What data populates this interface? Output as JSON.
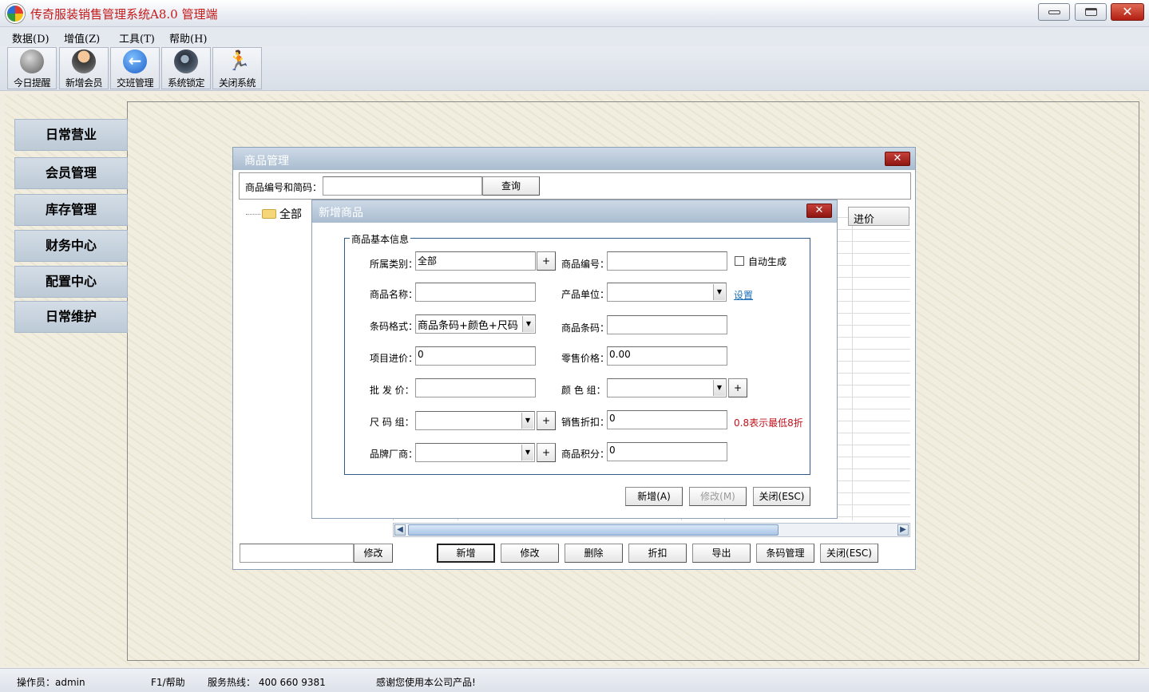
{
  "app": {
    "title": "传奇服装销售管理系统A8.0 管理端",
    "close_glyph": "✕"
  },
  "menu": [
    "数据(D)",
    "增值(Z)",
    "工具(T)",
    "帮助(H)"
  ],
  "toolbar": [
    "今日提醒",
    "新增会员",
    "交班管理",
    "系统锁定",
    "关闭系统"
  ],
  "nav": [
    "日常营业",
    "会员管理",
    "库存管理",
    "财务中心",
    "配置中心",
    "日常维护"
  ],
  "product_manager": {
    "title": "商品管理",
    "search_label": "商品编号和简码：",
    "search_value": "",
    "search_button": "查询",
    "tree_root": "全部",
    "grid_header": "进价",
    "bottom_input_value": "",
    "buttons": [
      "修改",
      "新增",
      "修改",
      "删除",
      "折扣",
      "导出",
      "条码管理",
      "关闭(ESC)"
    ]
  },
  "add_product": {
    "title": "新增商品",
    "group_title": "商品基本信息",
    "fields": {
      "category_label": "所属类别：",
      "category_value": "全部",
      "product_no_label": "商品编号：",
      "product_no_value": "",
      "auto_generate": "自动生成",
      "name_label": "商品名称：",
      "name_value": "",
      "unit_label": "产品单位：",
      "unit_value": "",
      "settings_link": "设置",
      "barcode_format_label": "条码格式：",
      "barcode_format_value": "商品条码+颜色+尺码",
      "barcode_label": "商品条码：",
      "barcode_value": "",
      "purchase_price_label": "项目进价：",
      "purchase_price_value": "0",
      "retail_price_label": "零售价格：",
      "retail_price_value": "0.00",
      "wholesale_label": "批 发 价：",
      "wholesale_value": "",
      "color_group_label": "颜 色 组：",
      "color_group_value": "",
      "size_group_label": "尺 码 组：",
      "size_group_value": "",
      "discount_label": "销售折扣：",
      "discount_value": "0",
      "discount_hint": "0.8表示最低8折",
      "brand_label": "品牌厂商：",
      "brand_value": "",
      "points_label": "商品积分：",
      "points_value": "0"
    },
    "plus": "+",
    "buttons": [
      "新增(A)",
      "修改(M)",
      "关闭(ESC)"
    ]
  },
  "status": {
    "operator": "操作员：admin",
    "help": "F1/帮助",
    "hotline": "服务热线： 400 660 9381",
    "thanks": "感谢您使用本公司产品!"
  }
}
